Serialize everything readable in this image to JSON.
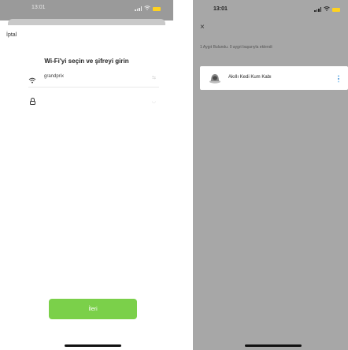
{
  "left": {
    "status_time": "13:01",
    "cancel_label": "İptal",
    "heading": "Wi-Fi'yi seçin ve şifreyi girin",
    "wifi_ssid": "grandprix",
    "password_value": "",
    "next_label": "İleri",
    "icons": [
      "signal-icon",
      "wifi-icon",
      "battery-icon",
      "wifi-icon",
      "swap-icon",
      "lock-icon",
      "eye-icon"
    ],
    "colors": {
      "primary_button": "#7bd04a",
      "battery": "#ffd21f"
    }
  },
  "right": {
    "status_time": "13:01",
    "close_label": "×",
    "found_text": "1 Aygıt Bulundu. 0 aygıt başarıyla eklendi",
    "device_name": "Akıllı Kedi Kum Kabı",
    "icons": [
      "signal-icon",
      "wifi-icon",
      "battery-icon",
      "close-icon",
      "litter-box-icon",
      "loading-icon"
    ]
  }
}
